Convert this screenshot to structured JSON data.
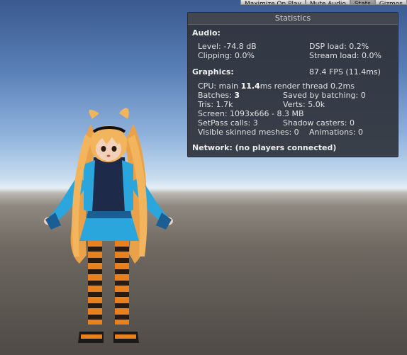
{
  "toolbar": {
    "maximize_label": "Maximize On Play",
    "mute_label": "Mute Audio",
    "stats_label": "Stats",
    "gizmos_label": "Gizmos"
  },
  "stats": {
    "title": "Statistics",
    "audio_header": "Audio:",
    "level": "Level: -74.8 dB",
    "clipping": "Clipping: 0.0%",
    "dsp_load": "DSP load: 0.2%",
    "stream_load": "Stream load: 0.0%",
    "graphics_header": "Graphics:",
    "fps": "87.4 FPS (11.4ms)",
    "cpu_prefix": "CPU: main ",
    "cpu_main": "11.4",
    "cpu_suffix": "ms  render thread 0.2ms",
    "batches_prefix": "Batches: ",
    "batches_value": "3",
    "saved_by_batching": "Saved by batching: 0",
    "tris": "Tris: 1.7k",
    "verts": "Verts: 5.0k",
    "screen": "Screen: 1093x666 - 8.3 MB",
    "setpass": "SetPass calls: 3",
    "shadow_casters": "Shadow casters: 0",
    "skinned_meshes": "Visible skinned meshes: 0",
    "animations": "Animations: 0",
    "network": "Network: (no players connected)"
  },
  "colors": {
    "panel_bg": "#30343c",
    "sky_top": "#3a5a90",
    "ground": "#6e6861",
    "hair": "#f2b45c",
    "outfit_blue": "#2aa6dc",
    "stripe_orange": "#e8801e"
  }
}
